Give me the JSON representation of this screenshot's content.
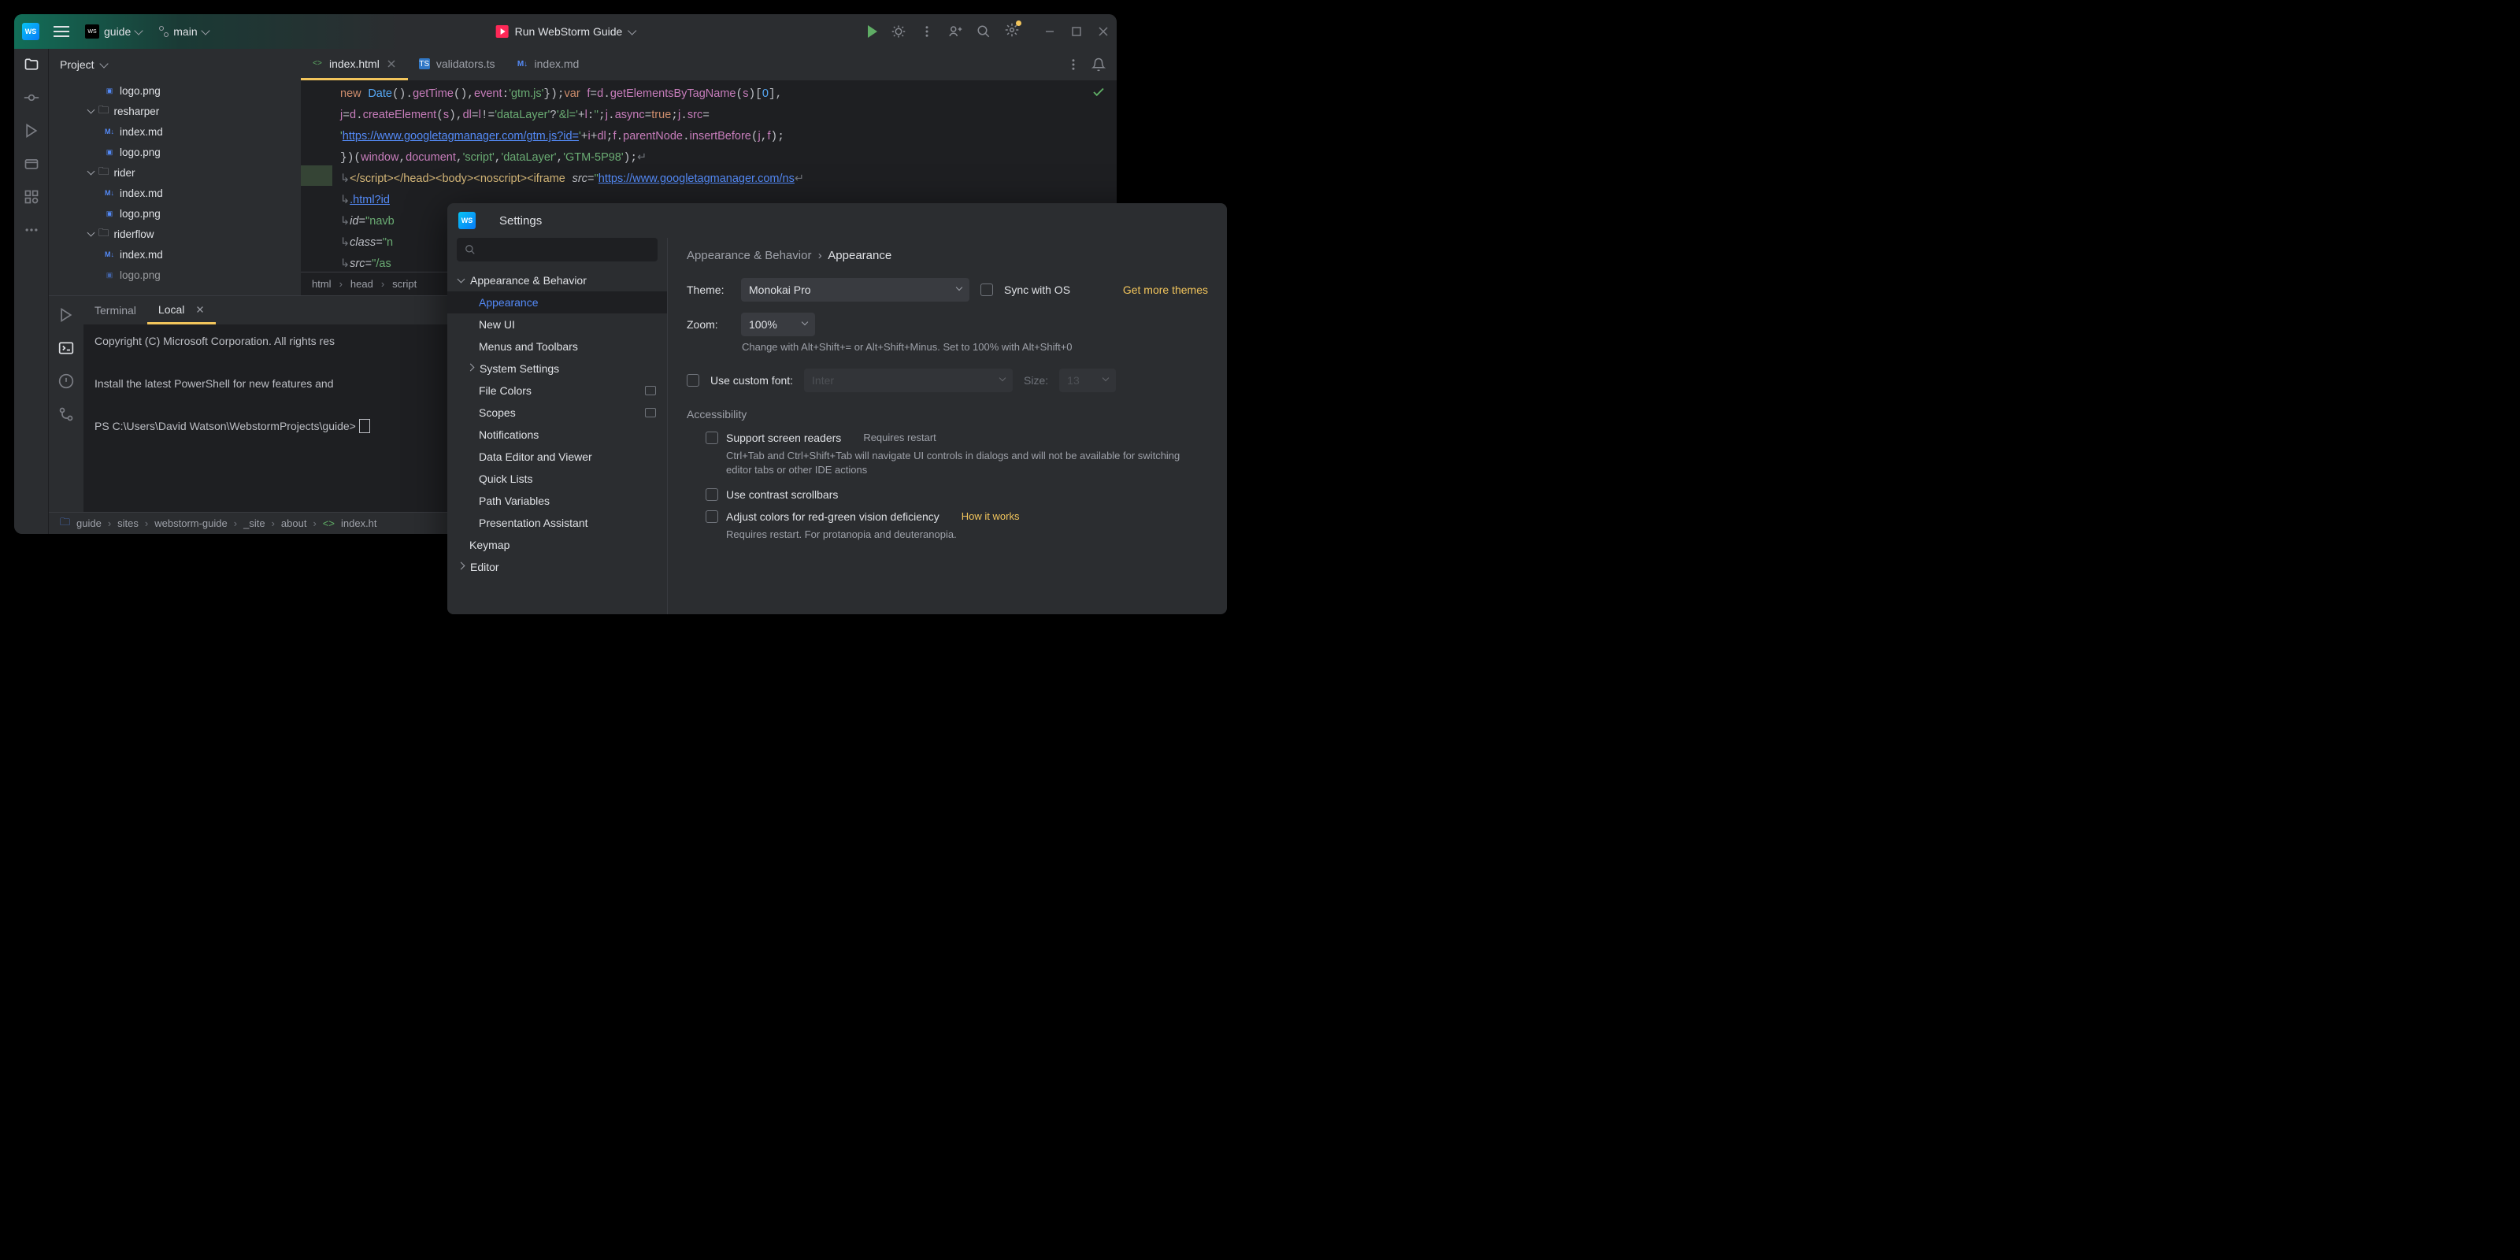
{
  "titlebar": {
    "ws_logo": "WS",
    "project_name": "guide",
    "branch": "main",
    "run_label": "Run WebStorm Guide"
  },
  "sidebar": {
    "header": "Project",
    "tree": [
      {
        "type": "file",
        "name": "logo.png",
        "icon": "image",
        "indent": 2
      },
      {
        "type": "folder",
        "name": "resharper",
        "indent": 1,
        "expanded": true
      },
      {
        "type": "file",
        "name": "index.md",
        "icon": "md",
        "indent": 2
      },
      {
        "type": "file",
        "name": "logo.png",
        "icon": "image",
        "indent": 2
      },
      {
        "type": "folder",
        "name": "rider",
        "indent": 1,
        "expanded": true
      },
      {
        "type": "file",
        "name": "index.md",
        "icon": "md",
        "indent": 2
      },
      {
        "type": "file",
        "name": "logo.png",
        "icon": "image",
        "indent": 2
      },
      {
        "type": "folder",
        "name": "riderflow",
        "indent": 1,
        "expanded": true
      },
      {
        "type": "file",
        "name": "index.md",
        "icon": "md",
        "indent": 2
      },
      {
        "type": "file",
        "name": "logo.png",
        "icon": "image",
        "indent": 2
      }
    ]
  },
  "tabs": [
    {
      "name": "index.html",
      "icon": "html",
      "active": true,
      "closable": true
    },
    {
      "name": "validators.ts",
      "icon": "ts",
      "active": false,
      "closable": false
    },
    {
      "name": "index.md",
      "icon": "md",
      "active": false,
      "closable": false
    }
  ],
  "breadcrumb_editor": [
    "html",
    "head",
    "script"
  ],
  "terminal": {
    "tabs": [
      {
        "name": "Terminal",
        "active": false
      },
      {
        "name": "Local",
        "active": true
      }
    ],
    "lines": [
      "Copyright (C) Microsoft Corporation. All rights res",
      "",
      "Install the latest PowerShell for new features and",
      "",
      "PS C:\\Users\\David Watson\\WebstormProjects\\guide> "
    ]
  },
  "statusbar": {
    "path": [
      "guide",
      "sites",
      "webstorm-guide",
      "_site",
      "about",
      "index.ht"
    ],
    "icon_file": "<>"
  },
  "settings": {
    "title": "Settings",
    "search_placeholder": "",
    "nav": {
      "appearance_behavior": "Appearance & Behavior",
      "items": [
        "Appearance",
        "New UI",
        "Menus and Toolbars",
        "System Settings",
        "File Colors",
        "Scopes",
        "Notifications",
        "Data Editor and Viewer",
        "Quick Lists",
        "Path Variables",
        "Presentation Assistant"
      ],
      "keymap": "Keymap",
      "editor": "Editor"
    },
    "content": {
      "crumb1": "Appearance & Behavior",
      "crumb2": "Appearance",
      "theme_label": "Theme:",
      "theme_value": "Monokai Pro",
      "sync_os": "Sync with OS",
      "get_themes": "Get more themes",
      "zoom_label": "Zoom:",
      "zoom_value": "100%",
      "zoom_hint": "Change with Alt+Shift+= or Alt+Shift+Minus. Set to 100% with Alt+Shift+0",
      "custom_font_label": "Use custom font:",
      "custom_font_value": "Inter",
      "size_label": "Size:",
      "size_value": "13",
      "accessibility_header": "Accessibility",
      "screen_readers": "Support screen readers",
      "requires_restart": "Requires restart",
      "screen_readers_desc": "Ctrl+Tab and Ctrl+Shift+Tab will navigate UI controls in dialogs and will not be available for switching editor tabs or other IDE actions",
      "contrast_scrollbars": "Use contrast scrollbars",
      "color_deficiency": "Adjust colors for red-green vision deficiency",
      "how_it_works": "How it works",
      "color_def_desc": "Requires restart. For protanopia and deuteranopia."
    }
  }
}
